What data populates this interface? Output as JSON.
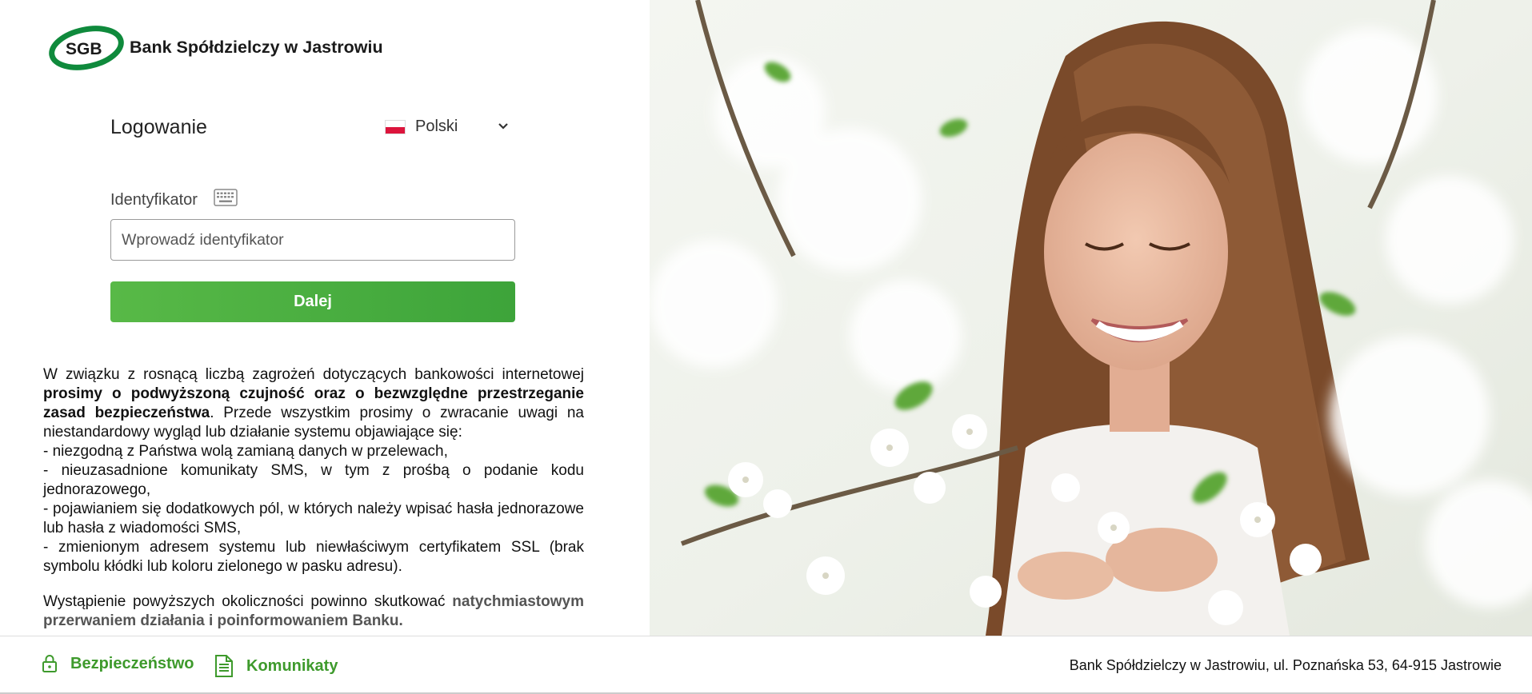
{
  "brand": {
    "logo_abbr": "SGB",
    "name": "Bank Spółdzielczy w Jastrowiu",
    "accent_color": "#3da43a",
    "logo_color": "#0f8a3c"
  },
  "login": {
    "title": "Logowanie",
    "language": {
      "selected": "Polski",
      "flag": "poland-flag-icon"
    },
    "identifier_label": "Identyfikator",
    "identifier_placeholder": "Wprowadź identyfikator",
    "identifier_value": "",
    "keyboard_icon": "virtual-keyboard-icon",
    "next_button": "Dalej"
  },
  "notice": {
    "p1_intro": "W związku z rosnącą liczbą zagrożeń dotyczących bankowości internetowej ",
    "p1_bold": "prosimy o podwyższoną czujność oraz o bezwzględne przestrzeganie zasad bezpieczeństwa",
    "p1_rest": ". Przede wszystkim prosimy o zwracanie uwagi na niestandardowy wygląd lub działanie systemu objawiające się:",
    "items": [
      "- niezgodną z Państwa wolą zamianą danych w przelewach,",
      "- nieuzasadnione komunikaty SMS, w tym z prośbą o podanie kodu jednorazowego,",
      "- pojawianiem się dodatkowych pól, w których należy wpisać hasła jednorazowe lub hasła z wiadomości SMS,",
      "- zmienionym adresem systemu lub niewłaściwym certyfikatem SSL (brak symbolu kłódki lub koloru zielonego w pasku adresu)."
    ],
    "p2_intro": "Wystąpienie powyższych okoliczności powinno skutkować ",
    "p2_bold": "natychmiastowym przerwaniem działania i poinformowaniem Banku."
  },
  "footer": {
    "security": {
      "label": "Bezpieczeństwo",
      "icon": "lock-icon"
    },
    "messages": {
      "label": "Komunikaty",
      "icon": "document-icon"
    },
    "address": "Bank Spółdzielczy w Jastrowiu, ul. Poznańska 53, 64-915 Jastrowie"
  }
}
